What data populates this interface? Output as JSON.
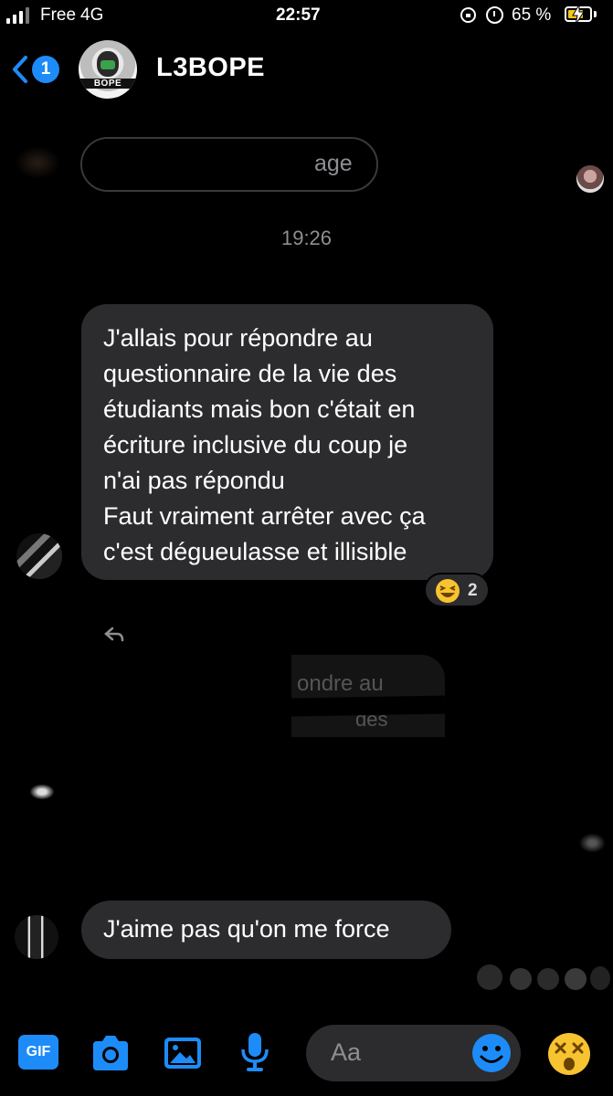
{
  "status": {
    "carrier": "Free",
    "network": "4G",
    "time": "22:57",
    "battery": "65 %"
  },
  "header": {
    "back_badge": "1",
    "avatar_text": "BOPE",
    "title": "L3BOPE"
  },
  "messages": {
    "partial_prev": "age",
    "timestamp": "19:26",
    "main_message": {
      "lines": [
        "J'allais pour répondre au",
        "questionnaire de la vie des",
        "étudiants mais bon c'était en",
        "écriture inclusive du coup je",
        "n'ai pas répondu",
        "Faut vraiment arrêter avec ça",
        "c'est dégueulasse et illisible"
      ],
      "reaction_count": "2"
    },
    "redacted_reply_fragments": [
      "ondre au",
      "des"
    ],
    "last_message": "J'aime pas qu'on me force"
  },
  "composer": {
    "gif_label": "GIF",
    "placeholder": "Aa"
  },
  "colors": {
    "accent": "#1d8cf8",
    "bubble": "#2c2c2e",
    "background": "#000000"
  }
}
